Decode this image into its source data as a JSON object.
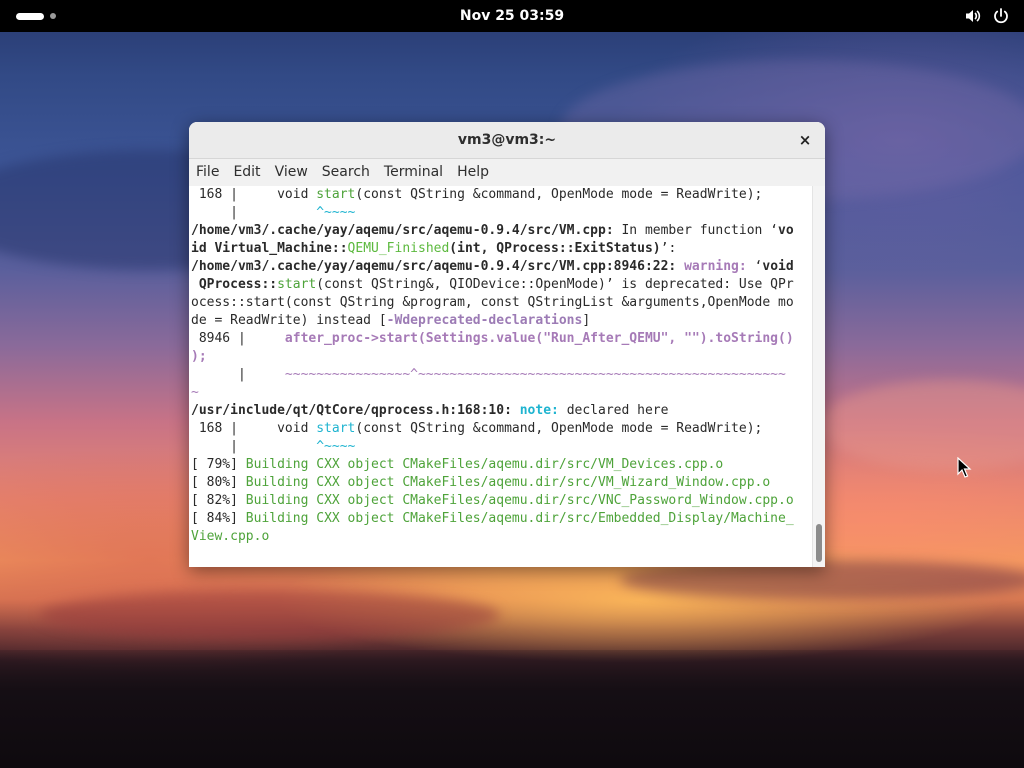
{
  "topbar": {
    "clock": "Nov 25  03:59",
    "icons": [
      "volume-icon",
      "power-icon"
    ]
  },
  "window": {
    "title": "vm3@vm3:~",
    "close_label": "×",
    "menu": [
      "File",
      "Edit",
      "View",
      "Search",
      "Terminal",
      "Help"
    ]
  },
  "terminal": {
    "lines": [
      [
        {
          "t": " 168 |     void "
        },
        {
          "t": "start",
          "c": "g"
        },
        {
          "t": "(const QString &command, OpenMode mode = ReadWrite);"
        }
      ],
      [
        {
          "t": "     |          "
        },
        {
          "t": "^~~~~",
          "c": "c"
        }
      ],
      [
        {
          "t": "/home/vm3/.cache/yay/aqemu/src/aqemu-0.9.4/src/VM.cpp:",
          "c": "b"
        },
        {
          "t": " In member function ‘"
        },
        {
          "t": "vo",
          "c": "b"
        }
      ],
      [
        {
          "t": "id Virtual_Machine::",
          "c": "b"
        },
        {
          "t": "QEMU_Finished",
          "c": "gb"
        },
        {
          "t": "(int, QProcess::ExitStatus)",
          "c": "b"
        },
        {
          "t": "’:"
        }
      ],
      [
        {
          "t": "/home/vm3/.cache/yay/aqemu/src/aqemu-0.9.4/src/VM.cpp:8946:22:",
          "c": "b"
        },
        {
          "t": " "
        },
        {
          "t": "warning:",
          "c": "mb"
        },
        {
          "t": " ‘"
        },
        {
          "t": "void",
          "c": "b"
        }
      ],
      [
        {
          "t": " QProcess::",
          "c": "b"
        },
        {
          "t": "start",
          "c": "g"
        },
        {
          "t": "(const QString&, QIODevice::OpenMode)’ is deprecated: Use QPr"
        }
      ],
      [
        {
          "t": "ocess::start(const QString &program, const QStringList &arguments,OpenMode mo"
        }
      ],
      [
        {
          "t": "de = ReadWrite) instead ["
        },
        {
          "t": "-Wdeprecated-declarations",
          "c": "bm"
        },
        {
          "t": "]"
        }
      ],
      [
        {
          "t": " 8946 |     "
        },
        {
          "t": "after_proc->start(Settings.value(\"Run_After_QEMU\", \"\").toString()",
          "c": "mb"
        }
      ],
      [
        {
          "t": ");",
          "c": "mb"
        }
      ],
      [
        {
          "t": "      |     "
        },
        {
          "t": "~~~~~~~~~~~~~~~~^~~~~~~~~~~~~~~~~~~~~~~~~~~~~~~~~~~~~~~~~~~~~~~~",
          "c": "m"
        }
      ],
      [
        {
          "t": "~",
          "c": "m"
        }
      ],
      [
        {
          "t": "/usr/include/qt/QtCore/qprocess.h:168:10:",
          "c": "b"
        },
        {
          "t": " "
        },
        {
          "t": "note:",
          "c": "cb"
        },
        {
          "t": " declared here"
        }
      ],
      [
        {
          "t": " 168 |     void "
        },
        {
          "t": "start",
          "c": "c"
        },
        {
          "t": "(const QString &command, OpenMode mode = ReadWrite);"
        }
      ],
      [
        {
          "t": "     |          "
        },
        {
          "t": "^~~~~",
          "c": "c"
        }
      ],
      [
        {
          "t": "[ 79%] "
        },
        {
          "t": "Building CXX object CMakeFiles/aqemu.dir/src/VM_Devices.cpp.o",
          "c": "g"
        }
      ],
      [
        {
          "t": "[ 80%] "
        },
        {
          "t": "Building CXX object CMakeFiles/aqemu.dir/src/VM_Wizard_Window.cpp.o",
          "c": "g"
        }
      ],
      [
        {
          "t": "[ 82%] "
        },
        {
          "t": "Building CXX object CMakeFiles/aqemu.dir/src/VNC_Password_Window.cpp.o",
          "c": "g"
        }
      ],
      [
        {
          "t": "[ 84%] "
        },
        {
          "t": "Building CXX object CMakeFiles/aqemu.dir/src/Embedded_Display/Machine_",
          "c": "g"
        }
      ],
      [
        {
          "t": "View.cpp.o",
          "c": "g"
        }
      ]
    ]
  }
}
